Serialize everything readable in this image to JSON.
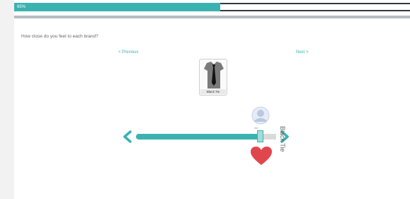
{
  "progress": {
    "label": "65%",
    "percent": 65,
    "fill_color": "#3ab3b0",
    "track_color": "#2f3b45"
  },
  "question": {
    "text": "How close do you feel to each brand?"
  },
  "navigation": {
    "previous_label": "< Previous",
    "next_label": "Next >"
  },
  "brand": {
    "name": "Black Tie",
    "image_icon": "shirt-tie-icon"
  },
  "rating": {
    "top_icon": "user-avatar-icon",
    "top_label": "me",
    "bottom_icon": "heart-icon",
    "value_fraction": 0.92,
    "vertical_label": "Black Tie",
    "accent_color": "#3ab3b0",
    "heart_color": "#e0474c"
  }
}
